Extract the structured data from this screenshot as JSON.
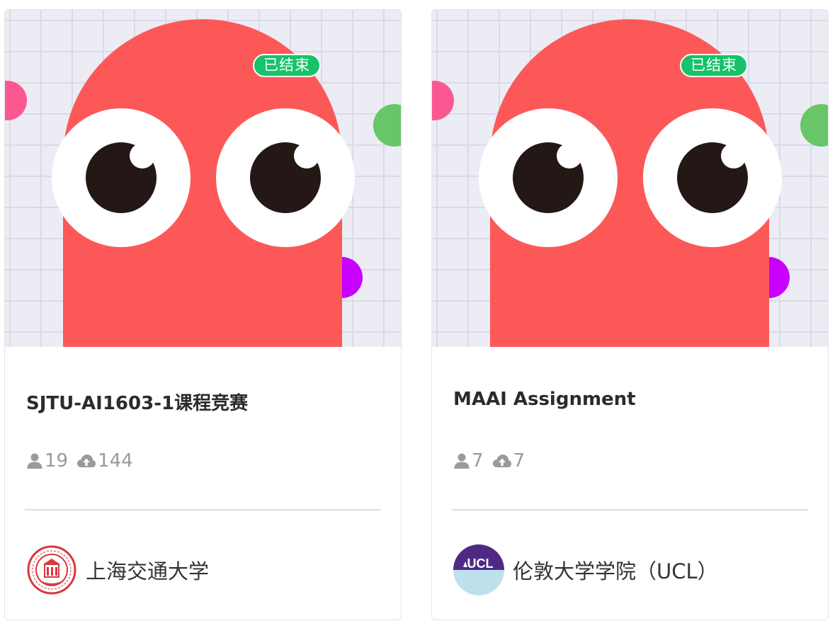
{
  "cards": [
    {
      "status_badge": "已结束",
      "title": "SJTU-AI1603-1课程竞赛",
      "participants": "19",
      "submissions": "144",
      "org_name": "上海交通大学",
      "org_logo_icon": "sjtu-seal-logo"
    },
    {
      "status_badge": "已结束",
      "title": "MAAI Assignment",
      "participants": "7",
      "submissions": "7",
      "org_name": "伦敦大学学院（UCL）",
      "org_logo_icon": "ucl-logo",
      "org_logo_text": "UCL"
    }
  ],
  "colors": {
    "badge_green": "#17c26a",
    "monster_red": "#fd5858",
    "eye_white": "#ffffff",
    "pupil": "#231815",
    "dot_pink": "#fb5892",
    "dot_green": "#67c668",
    "dot_purple": "#c800ff",
    "grid_bg": "#ececf4",
    "sjtu_red": "#d7383f",
    "ucl_purple": "#4e2a84",
    "ucl_blue": "#bde1ec"
  }
}
